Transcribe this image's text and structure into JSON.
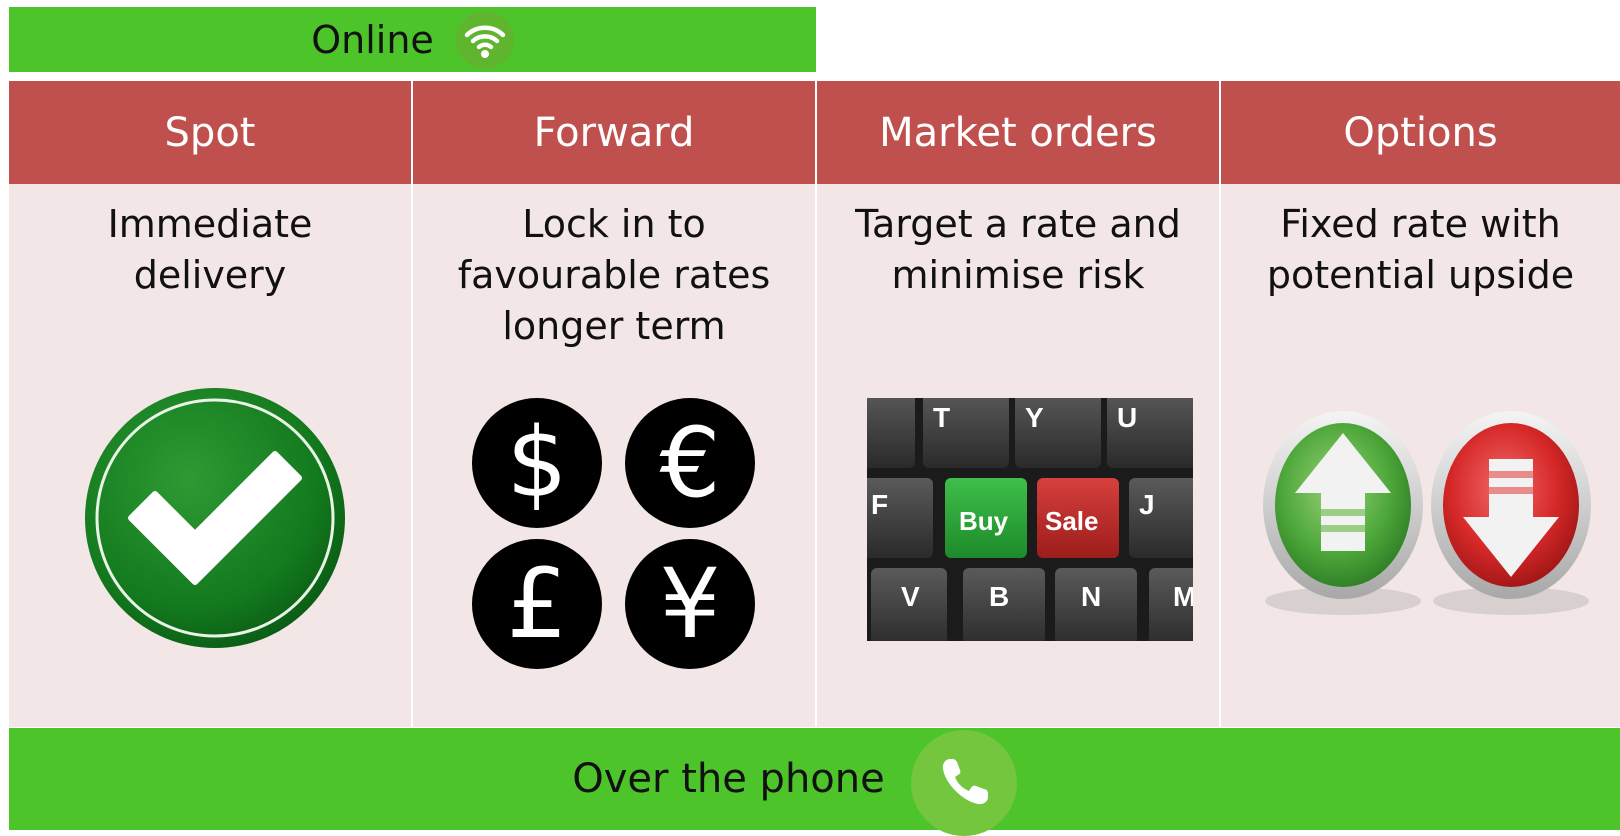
{
  "top_banner": {
    "label": "Online",
    "icon": "wifi-icon"
  },
  "columns": [
    {
      "title": "Spot",
      "description_lines": [
        "Immediate",
        "delivery"
      ],
      "icon": "checkmark-icon"
    },
    {
      "title": "Forward",
      "description_lines": [
        "Lock in to",
        "favourable rates",
        "longer term"
      ],
      "icon": "currency-coins-icon",
      "currency_symbols": [
        "$",
        "€",
        "£",
        "¥"
      ]
    },
    {
      "title": "Market orders",
      "description_lines": [
        "Target a rate and",
        "minimise risk"
      ],
      "icon": "keyboard-buy-sale-icon",
      "keyboard": {
        "top_row": [
          "T",
          "Y",
          "U"
        ],
        "middle_row": [
          "F",
          "Buy",
          "Sale",
          "J"
        ],
        "bottom_row": [
          "V",
          "B",
          "N",
          "M"
        ]
      }
    },
    {
      "title": "Options",
      "description_lines": [
        "Fixed rate with",
        "potential upside"
      ],
      "icon": "up-down-arrows-icon"
    }
  ],
  "bottom_banner": {
    "label": "Over the phone",
    "icon": "phone-icon"
  },
  "colors": {
    "green": "#4ec42b",
    "header_red": "#c0504d",
    "cell_bg": "#f2e6e6"
  }
}
